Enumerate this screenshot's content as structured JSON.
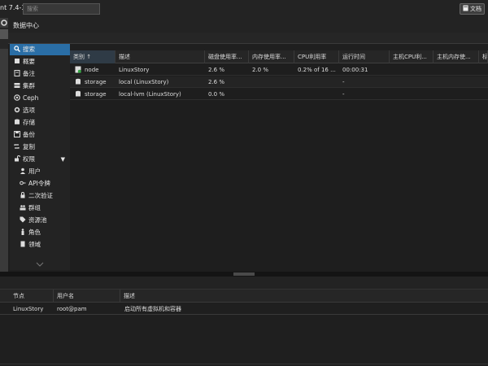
{
  "topbar": {
    "title": "nt 7.4-3",
    "search_placeholder": "搜索",
    "doc_button_label": "文档"
  },
  "breadcrumb": "数据中心",
  "nav": {
    "items": [
      {
        "label": "搜索",
        "icon": "search-icon",
        "active": true
      },
      {
        "label": "概要",
        "icon": "book-icon"
      },
      {
        "label": "备注",
        "icon": "note-icon"
      },
      {
        "label": "集群",
        "icon": "server-icon"
      },
      {
        "label": "Ceph",
        "icon": "ceph-icon"
      },
      {
        "label": "选项",
        "icon": "gear-icon"
      },
      {
        "label": "存储",
        "icon": "database-icon"
      },
      {
        "label": "备份",
        "icon": "floppy-icon"
      },
      {
        "label": "复制",
        "icon": "retweet-icon"
      },
      {
        "label": "权限",
        "icon": "unlock-icon",
        "expanded": true
      },
      {
        "label": "用户",
        "icon": "user-icon",
        "sub": true
      },
      {
        "label": "API令牌",
        "icon": "key-icon",
        "sub": true
      },
      {
        "label": "二次验证",
        "icon": "lock-icon",
        "sub": true
      },
      {
        "label": "群组",
        "icon": "users-icon",
        "sub": true
      },
      {
        "label": "资源池",
        "icon": "tags-icon",
        "sub": true
      },
      {
        "label": "角色",
        "icon": "male-icon",
        "sub": true
      },
      {
        "label": "领域",
        "icon": "building-icon",
        "sub": true
      }
    ]
  },
  "grid": {
    "columns": [
      "类别 ↑",
      "描述",
      "磁盘使用率...",
      "内存使用率...",
      "CPU利用率",
      "运行时间",
      "主机CPU利...",
      "主机内存使...",
      "标"
    ],
    "rows": [
      {
        "type": "node",
        "icon": "node-icon",
        "desc": "LinuxStory",
        "disk": "2.6 %",
        "mem": "2.0 %",
        "cpu": "0.2% of 16 ...",
        "uptime": "00:00:31"
      },
      {
        "type": "storage",
        "icon": "database-icon",
        "desc": "local (LinuxStory)",
        "disk": "2.6 %",
        "mem": "",
        "cpu": "",
        "uptime": "-"
      },
      {
        "type": "storage",
        "icon": "database-icon",
        "desc": "local-lvm (LinuxStory)",
        "disk": "0.0 %",
        "mem": "",
        "cpu": "",
        "uptime": "-"
      }
    ]
  },
  "tasks": {
    "columns": [
      "节点",
      "用户名",
      "描述"
    ],
    "rows": [
      {
        "node": "LinuxStory",
        "user": "root@pam",
        "desc": "启动所有虚拟机和容器"
      }
    ]
  },
  "colors": {
    "active": "#2a6ea6",
    "background": "#1e1e1e"
  }
}
